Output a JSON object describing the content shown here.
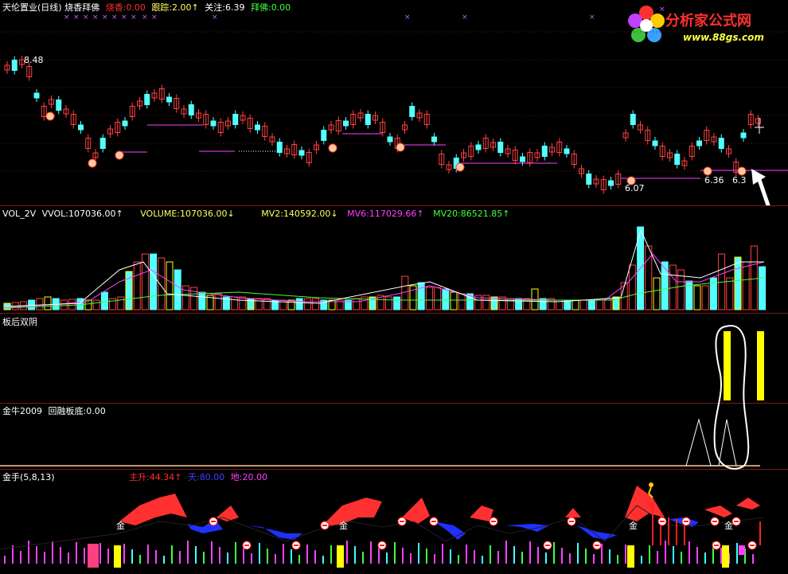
{
  "main": {
    "title": "天伦置业(日线) 烧香拜佛",
    "indicators": [
      {
        "label": "烧香:",
        "value": "0.00",
        "color": "#ff3030"
      },
      {
        "label": "跟踪:",
        "value": "2.00↑",
        "color": "#ffff60"
      },
      {
        "label": "关注:",
        "value": "6.39",
        "color": "#ffffff"
      },
      {
        "label": "拜佛:",
        "value": "0.00",
        "color": "#40ff40"
      }
    ],
    "high_label": "8.48",
    "low_label": "6.07",
    "right_label_a": "6.36",
    "right_label_b": "6.3"
  },
  "logo": {
    "title": "分析家公式网",
    "url": "www.88gs.com"
  },
  "volume": {
    "title": "VOL_2V",
    "items": [
      {
        "label": "VVOL:",
        "value": "107036.00↑",
        "color": "#ffffff"
      },
      {
        "label": "VOLUME:",
        "value": "107036.00↓",
        "color": "#ffff60"
      },
      {
        "label": "MV2:",
        "value": "140592.00↓",
        "color": "#ffff60"
      },
      {
        "label": "MV6:",
        "value": "117029.66↑",
        "color": "#ff40ff"
      },
      {
        "label": "MV20:",
        "value": "86521.85↑",
        "color": "#40ff40"
      }
    ]
  },
  "panel3": {
    "title": "板后双阴"
  },
  "panel4": {
    "title": "金牛2009",
    "items": [
      {
        "label": "回融板底:",
        "value": "0.00",
        "color": "#ffffff"
      }
    ]
  },
  "panel5": {
    "title": "金手(5,8,13)",
    "items": [
      {
        "label": "主升:",
        "value": "44.34↑",
        "color": "#ff3030"
      },
      {
        "label": "天:",
        "value": "80.00",
        "color": "#4040ff"
      },
      {
        "label": "地:",
        "value": "20.00",
        "color": "#ff40ff"
      }
    ],
    "markers": [
      "金",
      "金",
      "金",
      "金"
    ]
  },
  "colors": {
    "up": "#ff4040",
    "down": "#54ffff",
    "grid": "#7a1b1b",
    "bg": "#000000"
  }
}
